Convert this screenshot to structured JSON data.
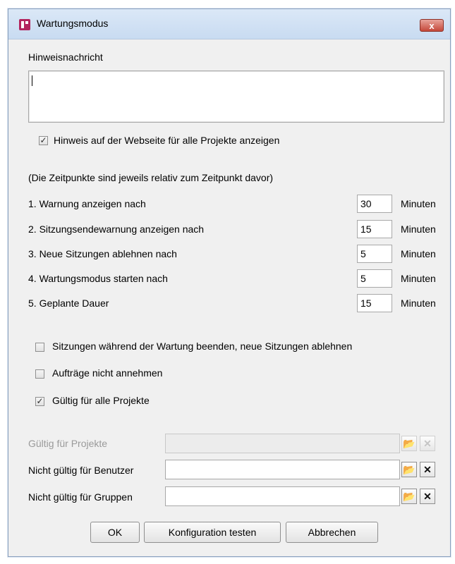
{
  "window": {
    "title": "Wartungsmodus",
    "close_label": "x"
  },
  "message": {
    "label": "Hinweisnachricht",
    "value": ""
  },
  "show_notice": {
    "label": "Hinweis auf der Webseite für alle Projekte anzeigen",
    "checked": true
  },
  "relative_note": "(Die Zeitpunkte sind jeweils relativ zum Zeitpunkt davor)",
  "timings": [
    {
      "label": "1. Warnung anzeigen nach",
      "value": "30",
      "unit": "Minuten"
    },
    {
      "label": "2. Sitzungsendewarnung anzeigen nach",
      "value": "15",
      "unit": "Minuten"
    },
    {
      "label": "3. Neue Sitzungen ablehnen nach",
      "value": "5",
      "unit": "Minuten"
    },
    {
      "label": "4. Wartungsmodus starten nach",
      "value": "5",
      "unit": "Minuten"
    },
    {
      "label": "5. Geplante Dauer",
      "value": "15",
      "unit": "Minuten"
    }
  ],
  "options": [
    {
      "label": "Sitzungen während der Wartung beenden, neue Sitzungen ablehnen",
      "checked": false
    },
    {
      "label": "Aufträge nicht annehmen",
      "checked": false
    },
    {
      "label": "Gültig für alle Projekte",
      "checked": true
    }
  ],
  "pickers": [
    {
      "label": "Gültig für Projekte",
      "value": "",
      "disabled": true
    },
    {
      "label": "Nicht gültig für Benutzer",
      "value": "",
      "disabled": false
    },
    {
      "label": "Nicht gültig für Gruppen",
      "value": "",
      "disabled": false
    }
  ],
  "buttons": {
    "ok": "OK",
    "test": "Konfiguration testen",
    "cancel": "Abbrechen"
  },
  "icons": {
    "browse": "folder-open-icon",
    "clear": "clear-x-icon"
  },
  "colors": {
    "titlebar": "#c8dbf1",
    "close": "#c5483a",
    "app_icon": "#b3245d"
  },
  "check_mark": "✓",
  "x_glyph": "✕"
}
